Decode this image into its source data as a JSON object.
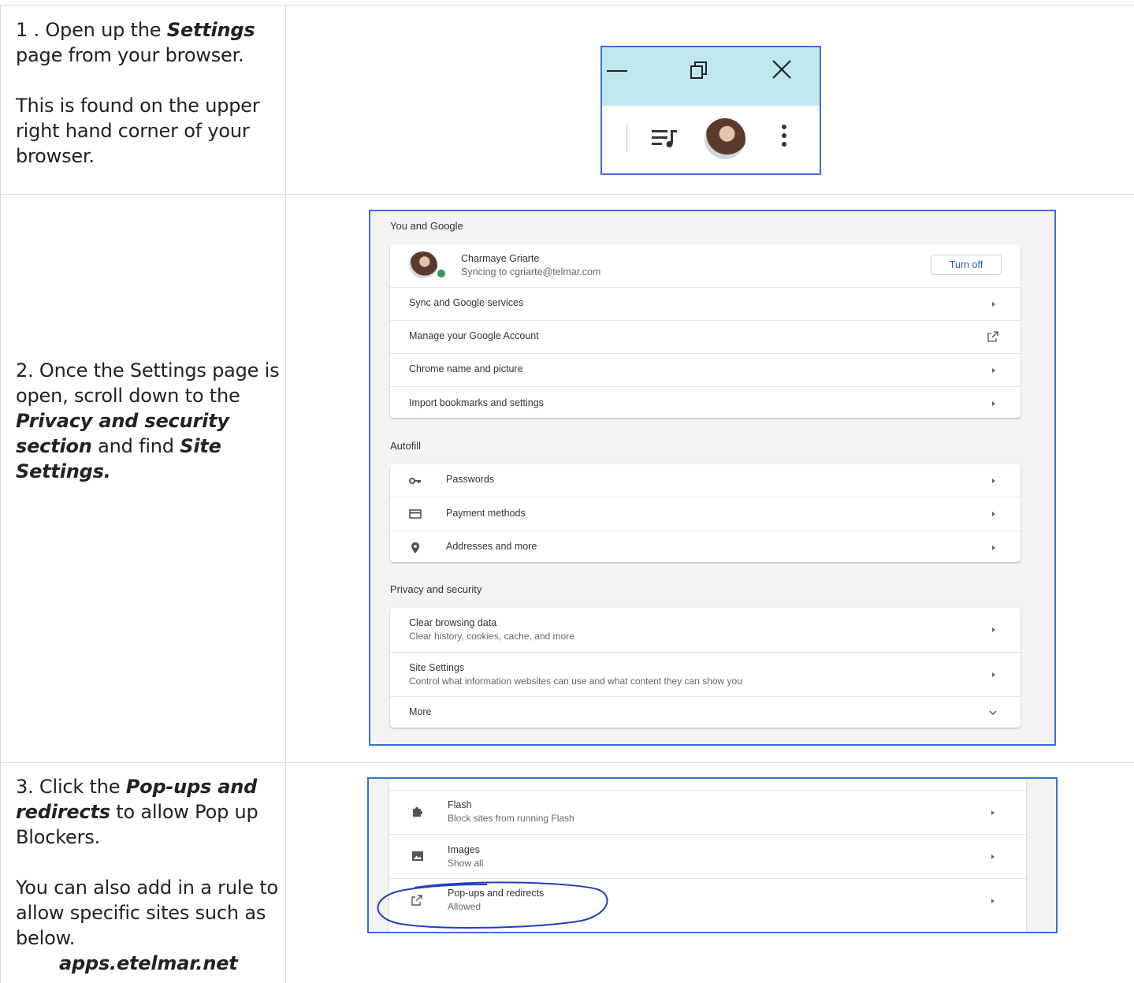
{
  "steps": [
    {
      "p1": {
        "before": "1 . Open up the ",
        "em": "Settings",
        "after": " page from your browser."
      },
      "p2": "This is found on the upper right hand corner of your browser."
    },
    {
      "p1": {
        "a": "2. Once the Settings page is open, scroll down to the ",
        "em1": "Privacy and security section",
        "b": " and find ",
        "em2": "Site Settings."
      }
    },
    {
      "p1": {
        "a": "3. Click the ",
        "em": "Pop-ups and redirects",
        "b": " to allow Pop up Blockers."
      },
      "p2": "You can also add in a rule to allow specific sites such as below.",
      "site": "apps.etelmar.net"
    }
  ],
  "settings": {
    "you_and_google": {
      "title": "You and Google",
      "profile_name": "Charmaye Griarte",
      "profile_sync": "Syncing to cgriarte@telmar.com",
      "turn_off_label": "Turn off",
      "rows": [
        "Sync and Google services",
        "Manage your Google Account",
        "Chrome name and picture",
        "Import bookmarks and settings"
      ]
    },
    "autofill": {
      "title": "Autofill",
      "rows": [
        "Passwords",
        "Payment methods",
        "Addresses and more"
      ]
    },
    "privacy": {
      "title": "Privacy and security",
      "clear_title": "Clear browsing data",
      "clear_sub": "Clear history, cookies, cache, and more",
      "site_title": "Site Settings",
      "site_sub": "Control what information websites can use and what content they can show you",
      "more": "More"
    }
  },
  "site_settings": [
    {
      "title": "Flash",
      "sub": "Block sites from running Flash",
      "icon": "puzzle-icon"
    },
    {
      "title": "Images",
      "sub": "Show all",
      "icon": "image-icon"
    },
    {
      "title": "Pop-ups and redirects",
      "sub": "Allowed",
      "icon": "open-in-new-icon"
    }
  ],
  "colors": {
    "highlight_border": "#3b6fd6",
    "titlebar": "#bfe7f0",
    "annotation": "#1f3fbf"
  }
}
